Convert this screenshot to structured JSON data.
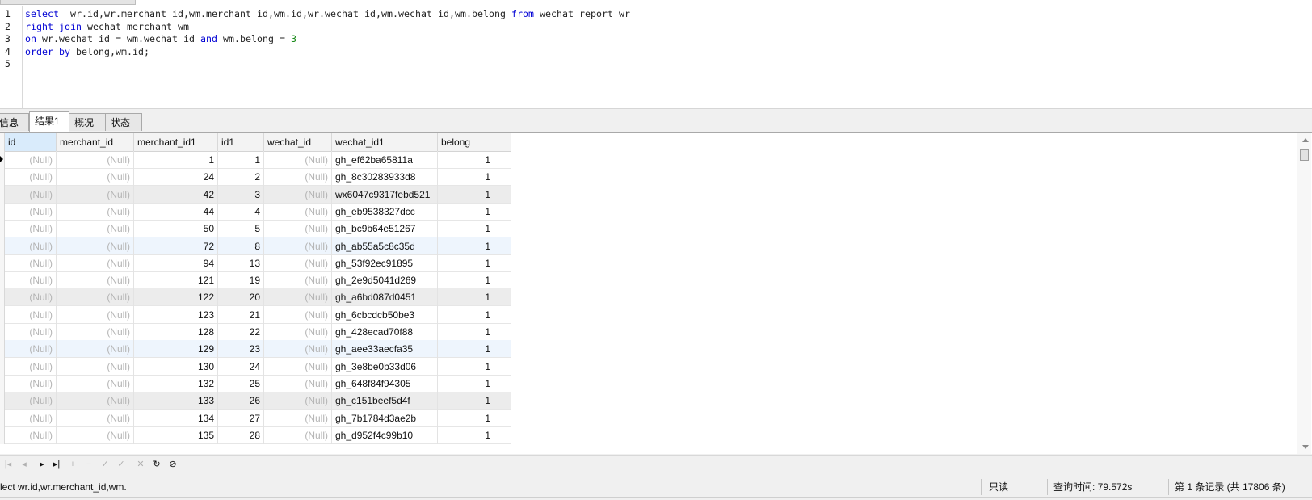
{
  "editor": {
    "lines": [
      {
        "num": "1",
        "parts": [
          [
            "kw",
            "select"
          ],
          [
            "",
            "  wr.id,wr.merchant_id,wm.merchant_id,wm.id,wr.wechat_id,wm.wechat_id,wm.belong "
          ],
          [
            "kw",
            "from"
          ],
          [
            "",
            " wechat_report wr"
          ]
        ]
      },
      {
        "num": "2",
        "parts": [
          [
            "kw",
            "right join"
          ],
          [
            "",
            " wechat_merchant wm"
          ]
        ]
      },
      {
        "num": "3",
        "parts": [
          [
            "kw",
            "on"
          ],
          [
            "",
            " wr.wechat_id = wm.wechat_id "
          ],
          [
            "kw",
            "and"
          ],
          [
            "",
            " wm.belong = "
          ],
          [
            "num",
            "3"
          ]
        ]
      },
      {
        "num": "4",
        "parts": [
          [
            "kw",
            "order by"
          ],
          [
            "",
            " belong,wm.id;"
          ]
        ]
      },
      {
        "num": "5",
        "parts": []
      }
    ]
  },
  "result_tabs": [
    {
      "label": "信息",
      "active": false
    },
    {
      "label": "结果1",
      "active": true
    },
    {
      "label": "概况",
      "active": false
    },
    {
      "label": "状态",
      "active": false
    }
  ],
  "grid": {
    "columns": [
      "id",
      "merchant_id",
      "merchant_id1",
      "id1",
      "wechat_id",
      "wechat_id1",
      "belong"
    ],
    "rows": [
      [
        "(Null)",
        "(Null)",
        "1",
        "1",
        "(Null)",
        "gh_ef62ba65811a",
        "1"
      ],
      [
        "(Null)",
        "(Null)",
        "24",
        "2",
        "(Null)",
        "gh_8c30283933d8",
        "1"
      ],
      [
        "(Null)",
        "(Null)",
        "42",
        "3",
        "(Null)",
        "wx6047c9317febd521",
        "1"
      ],
      [
        "(Null)",
        "(Null)",
        "44",
        "4",
        "(Null)",
        "gh_eb9538327dcc",
        "1"
      ],
      [
        "(Null)",
        "(Null)",
        "50",
        "5",
        "(Null)",
        "gh_bc9b64e51267",
        "1"
      ],
      [
        "(Null)",
        "(Null)",
        "72",
        "8",
        "(Null)",
        "gh_ab55a5c8c35d",
        "1"
      ],
      [
        "(Null)",
        "(Null)",
        "94",
        "13",
        "(Null)",
        "gh_53f92ec91895",
        "1"
      ],
      [
        "(Null)",
        "(Null)",
        "121",
        "19",
        "(Null)",
        "gh_2e9d5041d269",
        "1"
      ],
      [
        "(Null)",
        "(Null)",
        "122",
        "20",
        "(Null)",
        "gh_a6bd087d0451",
        "1"
      ],
      [
        "(Null)",
        "(Null)",
        "123",
        "21",
        "(Null)",
        "gh_6cbcdcb50be3",
        "1"
      ],
      [
        "(Null)",
        "(Null)",
        "128",
        "22",
        "(Null)",
        "gh_428ecad70f88",
        "1"
      ],
      [
        "(Null)",
        "(Null)",
        "129",
        "23",
        "(Null)",
        "gh_aee33aecfa35",
        "1"
      ],
      [
        "(Null)",
        "(Null)",
        "130",
        "24",
        "(Null)",
        "gh_3e8be0b33d06",
        "1"
      ],
      [
        "(Null)",
        "(Null)",
        "132",
        "25",
        "(Null)",
        "gh_648f84f94305",
        "1"
      ],
      [
        "(Null)",
        "(Null)",
        "133",
        "26",
        "(Null)",
        "gh_c151beef5d4f",
        "1"
      ],
      [
        "(Null)",
        "(Null)",
        "134",
        "27",
        "(Null)",
        "gh_7b1784d3ae2b",
        "1"
      ],
      [
        "(Null)",
        "(Null)",
        "135",
        "28",
        "(Null)",
        "gh_d952f4c99b10",
        "1"
      ]
    ]
  },
  "toolbar": {
    "buttons": [
      {
        "name": "first-record-icon",
        "glyph": "|◂",
        "enabled": false
      },
      {
        "name": "prev-record-icon",
        "glyph": "◂",
        "enabled": false
      },
      {
        "name": "next-record-icon",
        "glyph": "▸",
        "enabled": true
      },
      {
        "name": "last-record-icon",
        "glyph": "▸|",
        "enabled": true
      },
      {
        "name": "add-record-icon",
        "glyph": "+",
        "enabled": false
      },
      {
        "name": "delete-record-icon",
        "glyph": "−",
        "enabled": false
      },
      {
        "name": "apply-icon",
        "glyph": "✓",
        "enabled": false
      },
      {
        "name": "discard-icon",
        "glyph": "✓",
        "enabled": false
      },
      {
        "name": "cancel-icon",
        "glyph": "✕",
        "enabled": false
      },
      {
        "name": "refresh-icon",
        "glyph": "↻",
        "enabled": true
      },
      {
        "name": "stop-icon",
        "glyph": "⊘",
        "enabled": true
      }
    ]
  },
  "status": {
    "sql": "lect wr.id,wr.merchant_id,wm.",
    "readonly": "只读",
    "query_time": "查询时间: 79.572s",
    "record": "第 1 条记录 (共 17806 条)"
  }
}
